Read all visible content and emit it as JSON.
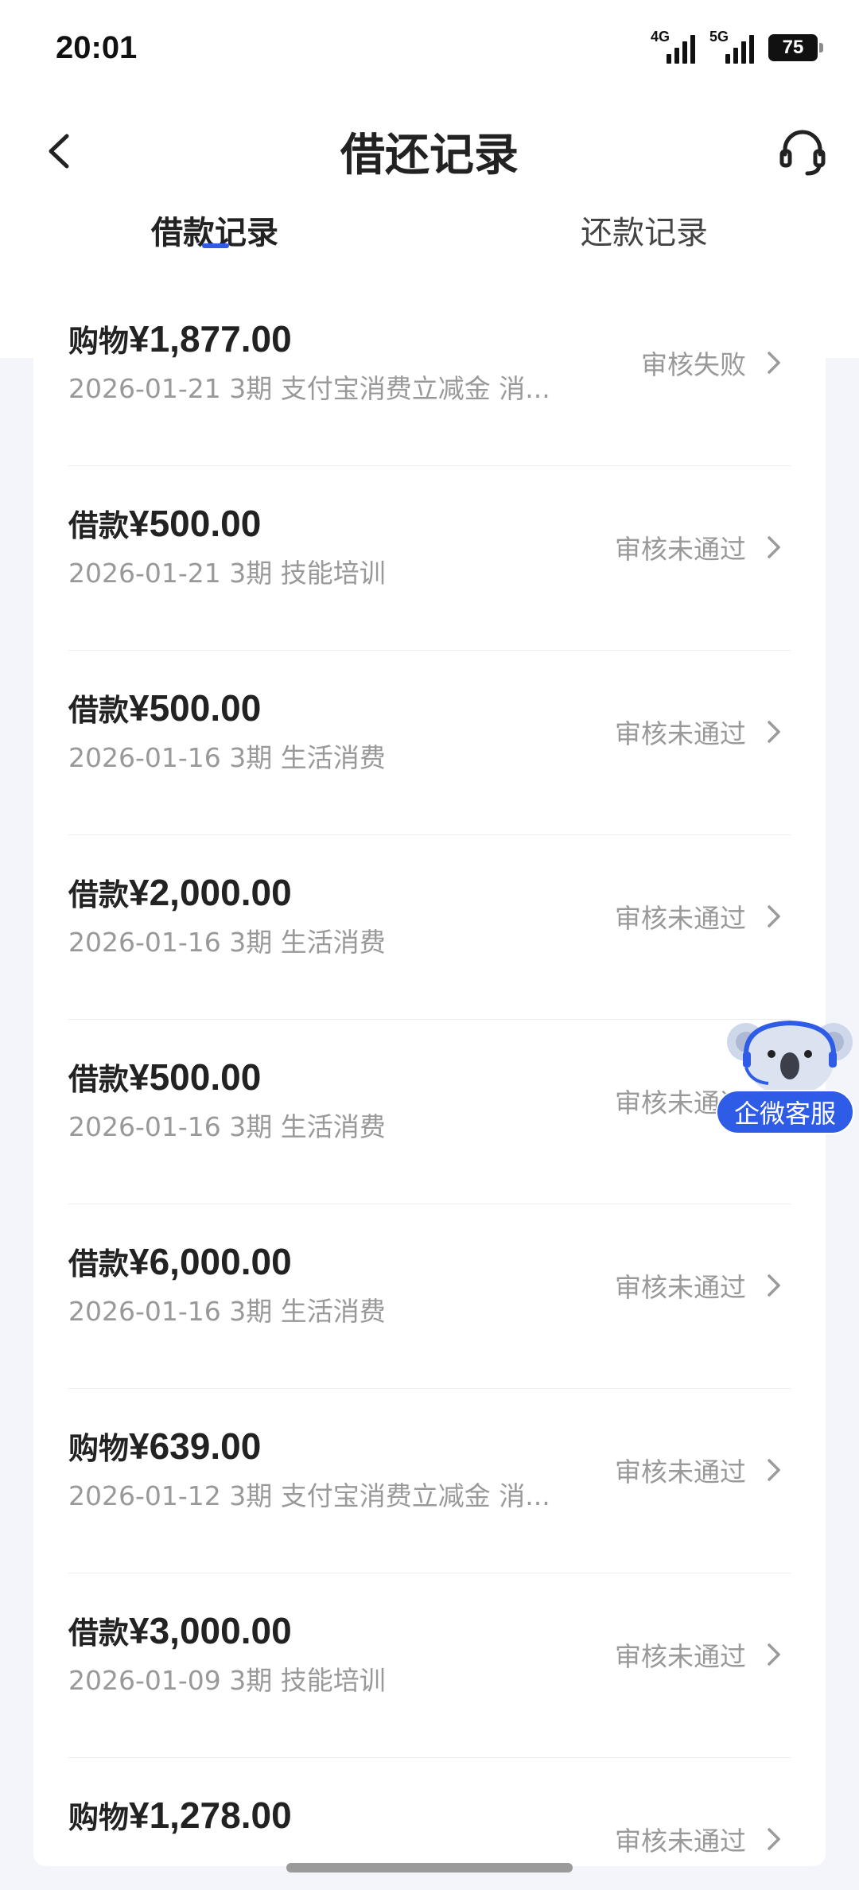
{
  "status_bar": {
    "time": "20:01",
    "signal_1_label": "4G",
    "signal_2_label": "5G",
    "battery": "75"
  },
  "header": {
    "title": "借还记录",
    "back_icon": "chevron-left-icon",
    "support_icon": "headset-icon"
  },
  "tabs": {
    "borrow": "借款记录",
    "repay": "还款记录",
    "active": "borrow",
    "accent_color": "#2f5fe0"
  },
  "records": [
    {
      "type": "购物",
      "amount": "¥1,877.00",
      "sub": "2026-01-21 3期  支付宝消费立减金 消...",
      "status": "审核失败"
    },
    {
      "type": "借款",
      "amount": "¥500.00",
      "sub": "2026-01-21 3期  技能培训",
      "status": "审核未通过"
    },
    {
      "type": "借款",
      "amount": "¥500.00",
      "sub": "2026-01-16 3期  生活消费",
      "status": "审核未通过"
    },
    {
      "type": "借款",
      "amount": "¥2,000.00",
      "sub": "2026-01-16 3期  生活消费",
      "status": "审核未通过"
    },
    {
      "type": "借款",
      "amount": "¥500.00",
      "sub": "2026-01-16 3期  生活消费",
      "status": "审核未通过"
    },
    {
      "type": "借款",
      "amount": "¥6,000.00",
      "sub": "2026-01-16 3期  生活消费",
      "status": "审核未通过"
    },
    {
      "type": "购物",
      "amount": "¥639.00",
      "sub": "2026-01-12 3期  支付宝消费立减金 消...",
      "status": "审核未通过"
    },
    {
      "type": "借款",
      "amount": "¥3,000.00",
      "sub": "2026-01-09 3期  技能培训",
      "status": "审核未通过"
    },
    {
      "type": "购物",
      "amount": "¥1,278.00",
      "sub": "",
      "status": "审核未通过"
    }
  ],
  "floating_service": {
    "label": "企微客服",
    "icon": "koala-mascot-icon",
    "color": "#2e5ce6"
  }
}
